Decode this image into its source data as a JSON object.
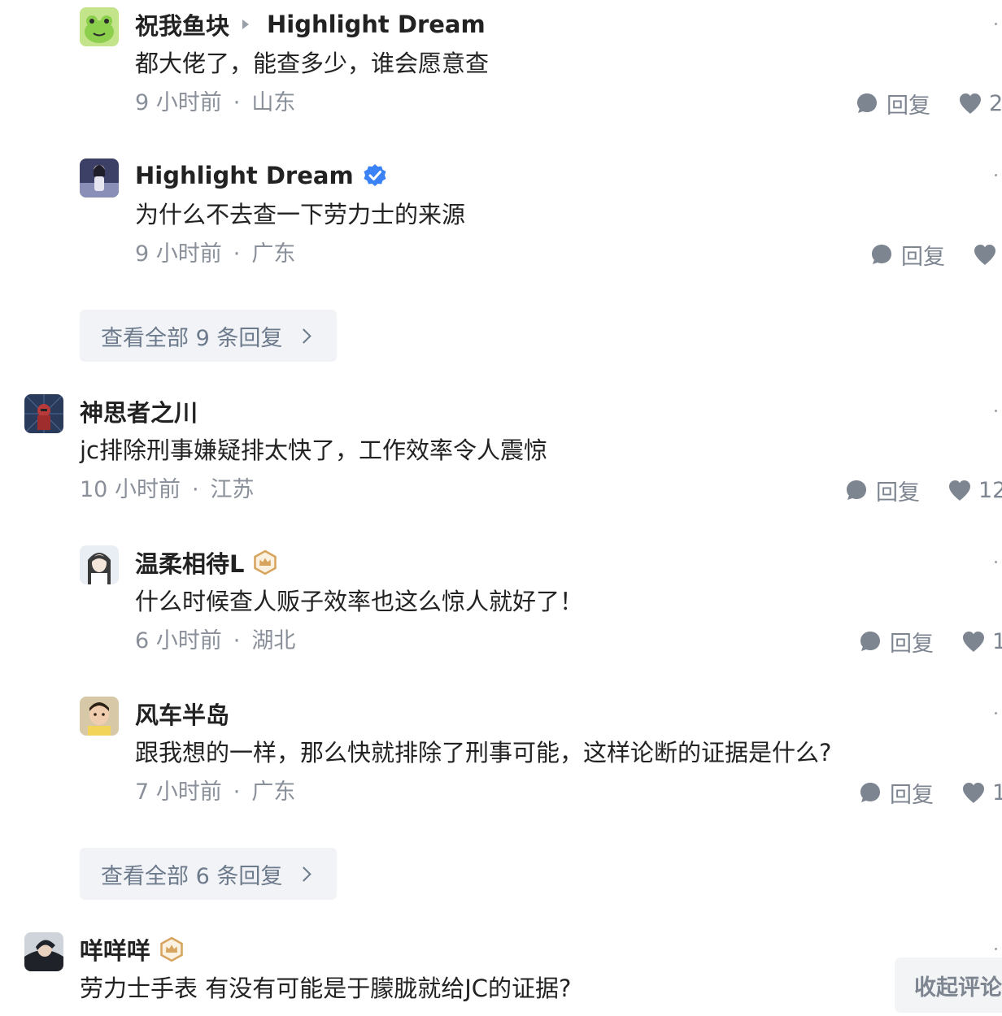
{
  "comments": [
    {
      "author": "祝我鱼块",
      "reply_to": "Highlight Dream",
      "content": "都大佬了，能查多少，谁会愿意查",
      "time": "9 小时前",
      "location": "山东",
      "reply_label": "回复",
      "likes": "2"
    },
    {
      "author": "Highlight Dream",
      "content": "为什么不去查一下劳力士的来源",
      "time": "9 小时前",
      "location": "广东",
      "reply_label": "回复",
      "likes": ""
    },
    {
      "author": "神思者之川",
      "content": "jc排除刑事嫌疑排太快了，工作效率令人震惊",
      "time": "10 小时前",
      "location": "江苏",
      "reply_label": "回复",
      "likes": "12"
    },
    {
      "author": "温柔相待L",
      "content": "什么时候查人贩子效率也这么惊人就好了！",
      "time": "6 小时前",
      "location": "湖北",
      "reply_label": "回复",
      "likes": "1"
    },
    {
      "author": "风车半岛",
      "content": "跟我想的一样，那么快就排除了刑事可能，这样论断的证据是什么?",
      "time": "7 小时前",
      "location": "广东",
      "reply_label": "回复",
      "likes": "1"
    },
    {
      "author": "咩咩咩",
      "content": "劳力士手表 有没有可能是于朦胧就给JC的证据?"
    }
  ],
  "view_all_1": "查看全部 9 条回复",
  "view_all_2": "查看全部 6 条回复",
  "collapse_label": "收起评论",
  "colors": {
    "text": "#222222",
    "meta": "#8a9099",
    "verified": "#3b82f6",
    "crown": "#d6a45c",
    "button_bg": "#f1f3f6"
  }
}
